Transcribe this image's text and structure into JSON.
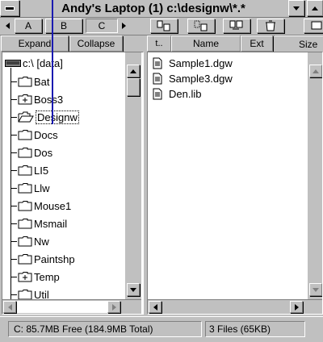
{
  "window": {
    "title": "Andy's Laptop (1) c:\\designw\\*.*"
  },
  "drive_bar": {
    "drives": [
      "A",
      "B",
      "C"
    ]
  },
  "tree_buttons": {
    "expand": "Expand",
    "collapse": "Collapse"
  },
  "file_columns": [
    "Name",
    "Ext",
    "Size"
  ],
  "tree": {
    "root": "c:\\ [data]",
    "items": [
      {
        "label": "Bat",
        "icon": "folder-icon"
      },
      {
        "label": "Boss3",
        "icon": "folder-plus-icon"
      },
      {
        "label": "Designw",
        "icon": "folder-open-icon",
        "selected": true
      },
      {
        "label": "Docs",
        "icon": "folder-icon"
      },
      {
        "label": "Dos",
        "icon": "folder-icon"
      },
      {
        "label": "LI5",
        "icon": "folder-icon"
      },
      {
        "label": "Llw",
        "icon": "folder-icon"
      },
      {
        "label": "Mouse1",
        "icon": "folder-icon"
      },
      {
        "label": "Msmail",
        "icon": "folder-icon"
      },
      {
        "label": "Nw",
        "icon": "folder-icon"
      },
      {
        "label": "Paintshp",
        "icon": "folder-icon"
      },
      {
        "label": "Temp",
        "icon": "folder-plus-icon"
      },
      {
        "label": "Util",
        "icon": "folder-icon"
      }
    ]
  },
  "files": [
    {
      "name": "Sample1.dgw",
      "icon": "document-icon"
    },
    {
      "name": "Sample3.dgw",
      "icon": "document-icon"
    },
    {
      "name": "Den.lib",
      "icon": "document-icon"
    }
  ],
  "status": {
    "free": "C: 85.7MB Free (184.9MB Total)",
    "files": "3 Files (65KB)"
  },
  "colors": {
    "face": "#c0c0c0",
    "selection_border": "#000080",
    "cursor_line": "#1a1ab0"
  }
}
